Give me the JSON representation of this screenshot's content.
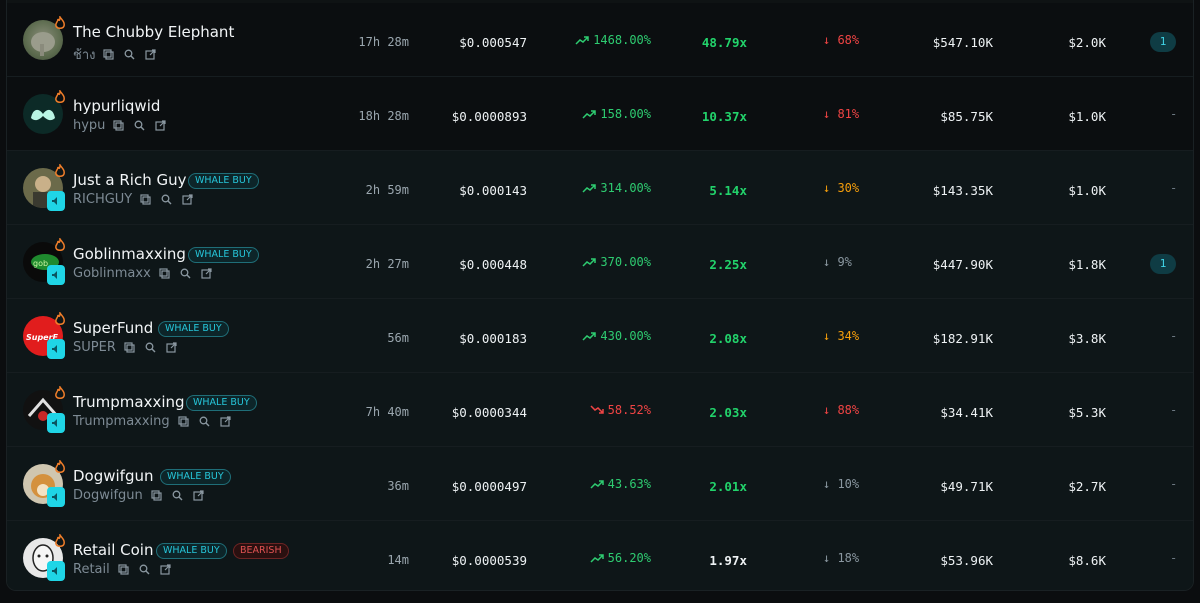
{
  "rows": [
    {
      "name": "The Chubby Elephant",
      "ticker": "ช้าง",
      "age": "17h 28m",
      "price": "$0.000547",
      "change": "1468.00%",
      "change_dir": "up",
      "multiple": "48.79x",
      "multiple_color": "green",
      "drop": "68%",
      "drop_color": "red",
      "mcap": "$547.10K",
      "volume": "$2.0K",
      "count": "1",
      "whale": false,
      "bearish": false,
      "bg": "dark"
    },
    {
      "name": "hypurliqwid",
      "ticker": "hypu",
      "age": "18h 28m",
      "price": "$0.0000893",
      "change": "158.00%",
      "change_dir": "up",
      "multiple": "10.37x",
      "multiple_color": "green",
      "drop": "81%",
      "drop_color": "red",
      "mcap": "$85.75K",
      "volume": "$1.0K",
      "count": "-",
      "whale": false,
      "bearish": false,
      "bg": "dark"
    },
    {
      "name": "Just a Rich Guy",
      "ticker": "RICHGUY",
      "age": "2h 59m",
      "price": "$0.000143",
      "change": "314.00%",
      "change_dir": "up",
      "multiple": "5.14x",
      "multiple_color": "green",
      "drop": "30%",
      "drop_color": "orange",
      "mcap": "$143.35K",
      "volume": "$1.0K",
      "count": "-",
      "whale": true,
      "bearish": false,
      "bg": "teal"
    },
    {
      "name": "Goblinmaxxing",
      "ticker": "Goblinmaxx",
      "age": "2h 27m",
      "price": "$0.000448",
      "change": "370.00%",
      "change_dir": "up",
      "multiple": "2.25x",
      "multiple_color": "green",
      "drop": "9%",
      "drop_color": "gray",
      "mcap": "$447.90K",
      "volume": "$1.8K",
      "count": "1",
      "whale": true,
      "bearish": false,
      "bg": "teal"
    },
    {
      "name": "SuperFund",
      "ticker": "SUPER",
      "age": "56m",
      "price": "$0.000183",
      "change": "430.00%",
      "change_dir": "up",
      "multiple": "2.08x",
      "multiple_color": "green",
      "drop": "34%",
      "drop_color": "orange",
      "mcap": "$182.91K",
      "volume": "$3.8K",
      "count": "-",
      "whale": true,
      "bearish": false,
      "bg": "teal"
    },
    {
      "name": "Trumpmaxxing",
      "ticker": "Trumpmaxxing",
      "age": "7h 40m",
      "price": "$0.0000344",
      "change": "58.52%",
      "change_dir": "down",
      "multiple": "2.03x",
      "multiple_color": "green",
      "drop": "88%",
      "drop_color": "red",
      "mcap": "$34.41K",
      "volume": "$5.3K",
      "count": "-",
      "whale": true,
      "bearish": false,
      "bg": "teal"
    },
    {
      "name": "Dogwifgun",
      "ticker": "Dogwifgun",
      "age": "36m",
      "price": "$0.0000497",
      "change": "43.63%",
      "change_dir": "up",
      "multiple": "2.01x",
      "multiple_color": "green",
      "drop": "10%",
      "drop_color": "gray",
      "mcap": "$49.71K",
      "volume": "$2.7K",
      "count": "-",
      "whale": true,
      "bearish": false,
      "bg": "teal"
    },
    {
      "name": "Retail Coin",
      "ticker": "Retail",
      "age": "14m",
      "price": "$0.0000539",
      "change": "56.20%",
      "change_dir": "up",
      "multiple": "1.97x",
      "multiple_color": "white",
      "drop": "18%",
      "drop_color": "gray",
      "mcap": "$53.96K",
      "volume": "$8.6K",
      "count": "-",
      "whale": true,
      "bearish": true,
      "bg": "teal"
    }
  ],
  "labels": {
    "whale_badge": "WHALE BUY",
    "bearish_badge": "BEARISH"
  },
  "icons": {
    "hot": "flame-icon",
    "copy": "copy-icon",
    "search": "search-icon",
    "open": "external-link-icon",
    "whale": "speaker-icon"
  },
  "colors": {
    "up": "#2ecc71",
    "down": "#ef4444",
    "orange": "#f59e0b",
    "teal": "#26c6da"
  }
}
